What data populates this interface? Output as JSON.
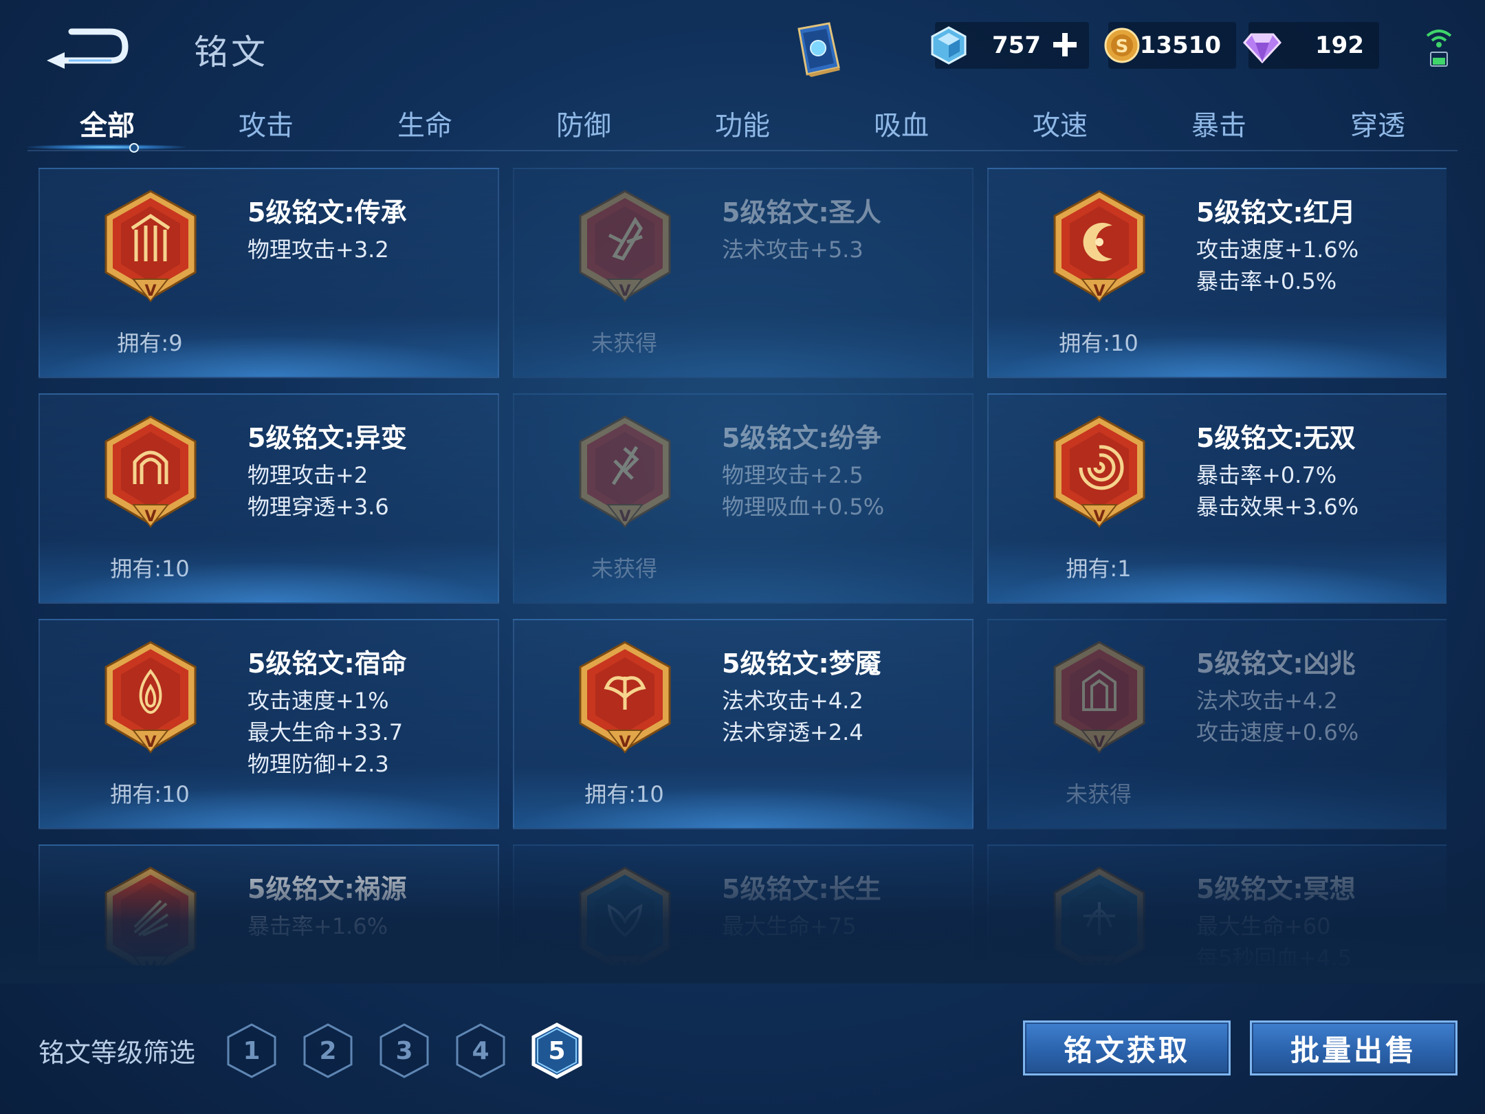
{
  "header": {
    "title": "铭文",
    "crystals": "757",
    "gold": "13510",
    "diamonds": "192"
  },
  "tabs": [
    {
      "label": "全部"
    },
    {
      "label": "攻击"
    },
    {
      "label": "生命"
    },
    {
      "label": "防御"
    },
    {
      "label": "功能"
    },
    {
      "label": "吸血"
    },
    {
      "label": "攻速"
    },
    {
      "label": "暴击"
    },
    {
      "label": "穿透"
    }
  ],
  "active_tab": "全部",
  "cards": [
    {
      "name": "5级铭文:传承",
      "attrs": [
        "物理攻击+3.2"
      ],
      "owned": "拥有:9",
      "acquired": true,
      "emblem": "pillars-emblem"
    },
    {
      "name": "5级铭文:圣人",
      "attrs": [
        "法术攻击+5.3"
      ],
      "owned": "未获得",
      "acquired": false,
      "emblem": "crystal-emblem"
    },
    {
      "name": "5级铭文:红月",
      "attrs": [
        "攻击速度+1.6%",
        "暴击率+0.5%"
      ],
      "owned": "拥有:10",
      "acquired": true,
      "emblem": "moon-emblem"
    },
    {
      "name": "5级铭文:异变",
      "attrs": [
        "物理攻击+2",
        "物理穿透+3.6"
      ],
      "owned": "拥有:10",
      "acquired": true,
      "emblem": "gate-emblem"
    },
    {
      "name": "5级铭文:纷争",
      "attrs": [
        "物理攻击+2.5",
        "物理吸血+0.5%"
      ],
      "owned": "未获得",
      "acquired": false,
      "emblem": "blade-emblem"
    },
    {
      "name": "5级铭文:无双",
      "attrs": [
        "暴击率+0.7%",
        "暴击效果+3.6%"
      ],
      "owned": "拥有:1",
      "acquired": true,
      "emblem": "spiral-emblem"
    },
    {
      "name": "5级铭文:宿命",
      "attrs": [
        "攻击速度+1%",
        "最大生命+33.7",
        "物理防御+2.3"
      ],
      "owned": "拥有:10",
      "acquired": true,
      "emblem": "flame-emblem"
    },
    {
      "name": "5级铭文:梦魇",
      "attrs": [
        "法术攻击+4.2",
        "法术穿透+2.4"
      ],
      "owned": "拥有:10",
      "acquired": true,
      "emblem": "wing-emblem"
    },
    {
      "name": "5级铭文:凶兆",
      "attrs": [
        "法术攻击+4.2",
        "攻击速度+0.6%"
      ],
      "owned": "未获得",
      "acquired": false,
      "emblem": "omen-emblem"
    },
    {
      "name": "5级铭文:祸源",
      "attrs": [
        "暴击率+1.6%"
      ],
      "owned": "",
      "acquired": true,
      "emblem": "fan-emblem"
    },
    {
      "name": "5级铭文:长生",
      "attrs": [
        "最大生命+75"
      ],
      "owned": "",
      "acquired": false,
      "emblem": "leaf-emblem"
    },
    {
      "name": "5级铭文:冥想",
      "attrs": [
        "最大生命+60",
        "每5秒回血+4.5"
      ],
      "owned": "",
      "acquired": false,
      "emblem": "lotus-emblem"
    }
  ],
  "filter": {
    "label": "铭文等级筛选",
    "levels": [
      "1",
      "2",
      "3",
      "4",
      "5"
    ],
    "selected": "5"
  },
  "buttons": {
    "acquire": "铭文获取",
    "sell": "批量出售"
  },
  "colors": {
    "background": "#10305a",
    "tab_active": "#ffffff",
    "tab_inactive": "#8fb8e6",
    "emblem_red": "#c8361f",
    "emblem_gold": "#e2a64a",
    "button_blue": "#2b63ad"
  }
}
